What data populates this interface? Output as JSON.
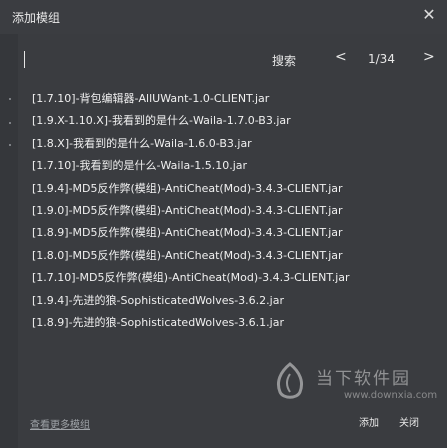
{
  "dialog": {
    "title": "添加模组",
    "close_glyph": "✕"
  },
  "search": {
    "value": "",
    "placeholder": "",
    "search_label": "搜索",
    "prev_glyph": "<",
    "next_glyph": ">",
    "page_indicator": "1/34"
  },
  "results": [
    "[1.7.10]-背包编辑器-AllUWant-1.0-CLIENT.jar",
    "[1.9.X-1.10.X]-我看到的是什么-Waila-1.7.0-B3.jar",
    "[1.8.X]-我看到的是什么-Waila-1.6.0-B3.jar",
    "[1.7.10]-我看到的是什么-Waila-1.5.10.jar",
    "[1.9.4]-MD5反作弊(模组)-AntiCheat(Mod)-3.4.3-CLIENT.jar",
    "[1.9.0]-MD5反作弊(模组)-AntiCheat(Mod)-3.4.3-CLIENT.jar",
    "[1.8.9]-MD5反作弊(模组)-AntiCheat(Mod)-3.4.3-CLIENT.jar",
    "[1.8.0]-MD5反作弊(模组)-AntiCheat(Mod)-3.4.3-CLIENT.jar",
    "[1.7.10]-MD5反作弊(模组)-AntiCheat(Mod)-3.4.3-CLIENT.jar",
    "[1.9.4]-先进的狼-SophisticatedWolves-3.6.2.jar",
    "[1.8.9]-先进的狼-SophisticatedWolves-3.6.1.jar"
  ],
  "footer": {
    "more_link": "查看更多模组",
    "confirm_label": "添加",
    "cancel_label": "关闭"
  },
  "watermark": {
    "name": "当下软件园",
    "url": "www.downxia.com"
  },
  "colors": {
    "background": "#3a3c40",
    "text": "#f0f0f0"
  }
}
